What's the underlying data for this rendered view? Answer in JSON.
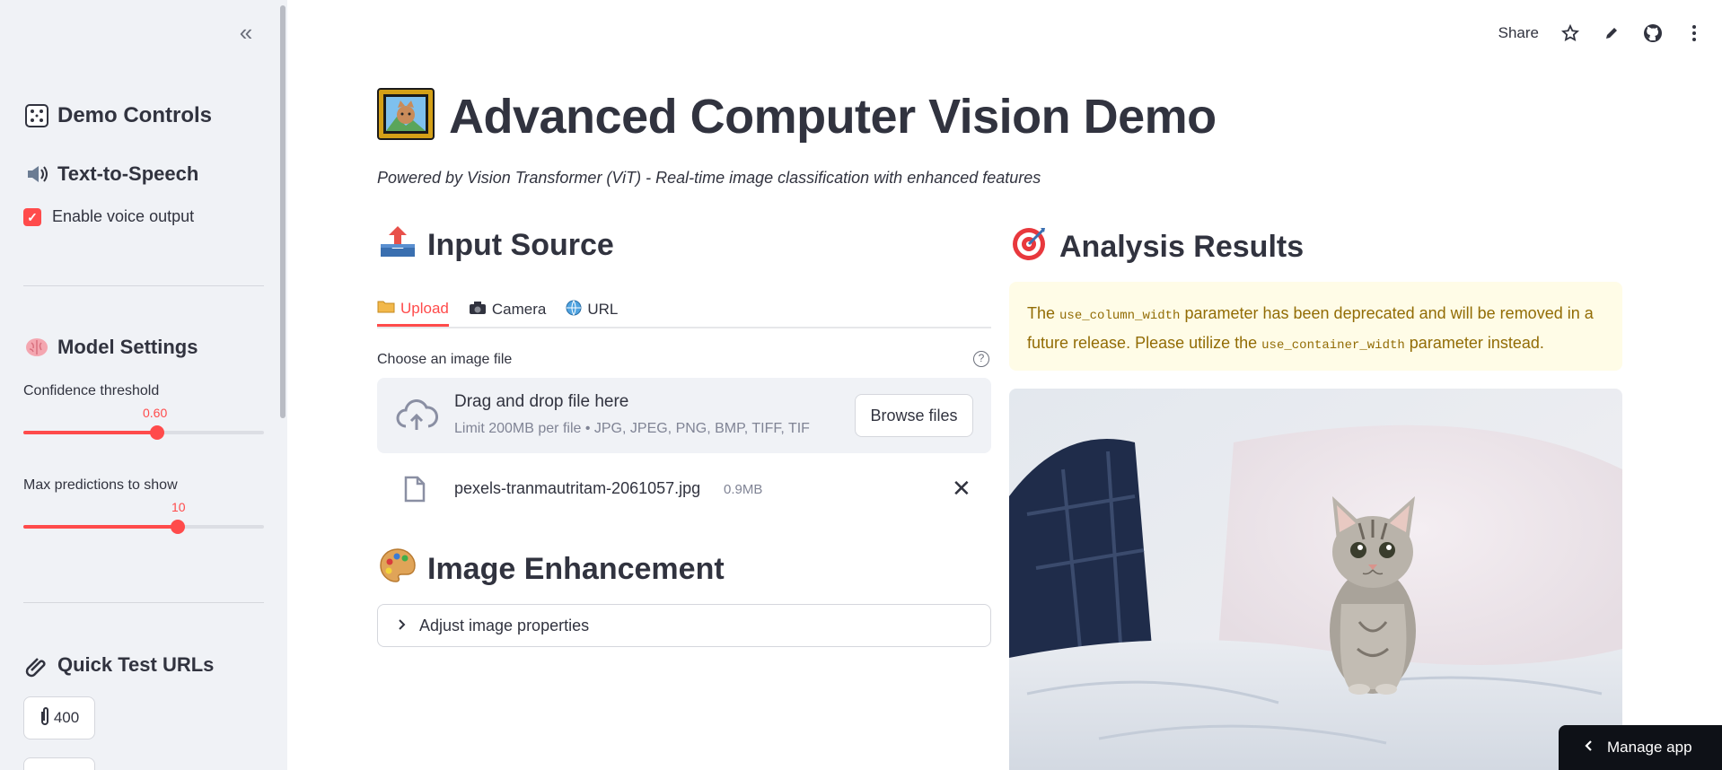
{
  "sidebar": {
    "collapse_label": "«",
    "demo_controls": {
      "icon": "gamepad-icon",
      "label": "Demo Controls"
    },
    "tts": {
      "icon": "speaker-icon",
      "label": "Text-to-Speech"
    },
    "voice_checkbox": {
      "label": "Enable voice output",
      "checked": true
    },
    "model_settings": {
      "icon": "brain-icon",
      "label": "Model Settings"
    },
    "confidence": {
      "label": "Confidence threshold",
      "value": "0.60",
      "fraction": 0.555
    },
    "max_predictions": {
      "label": "Max predictions to show",
      "value": "10",
      "fraction": 0.64
    },
    "quick_test": {
      "icon": "paperclips-icon",
      "label": "Quick Test URLs"
    },
    "quick_buttons": [
      {
        "label": "400"
      }
    ]
  },
  "toolbar": {
    "share_label": "Share"
  },
  "main": {
    "title": "Advanced Computer Vision Demo",
    "subtitle": "Powered by Vision Transformer (ViT) - Real-time image classification with enhanced features",
    "input_source": {
      "label": "Input Source"
    },
    "tabs": [
      {
        "label": "Upload",
        "active": true
      },
      {
        "label": "Camera",
        "active": false
      },
      {
        "label": "URL",
        "active": false
      }
    ],
    "uploader": {
      "label": "Choose an image file",
      "drop_title": "Drag and drop file here",
      "limit": "Limit 200MB per file • JPG, JPEG, PNG, BMP, TIFF, TIF",
      "browse_label": "Browse files"
    },
    "file": {
      "name": "pexels-tranmautritam-2061057.jpg",
      "size": "0.9MB"
    },
    "enhancement": {
      "label": "Image Enhancement",
      "expander_label": "Adjust image properties"
    },
    "analysis": {
      "label": "Analysis Results"
    },
    "warning": {
      "text_1": "The ",
      "code_1": "use_column_width",
      "text_2": " parameter has been deprecated and will be removed in a future release. Please utilize the ",
      "code_2": "use_container_width",
      "text_3": " parameter instead."
    }
  },
  "manage_app": {
    "label": "Manage app"
  },
  "colors": {
    "accent": "#ff4b4b",
    "warning_bg": "#fffce7",
    "warning_text": "#926c05",
    "sidebar_bg": "#f0f2f6"
  }
}
